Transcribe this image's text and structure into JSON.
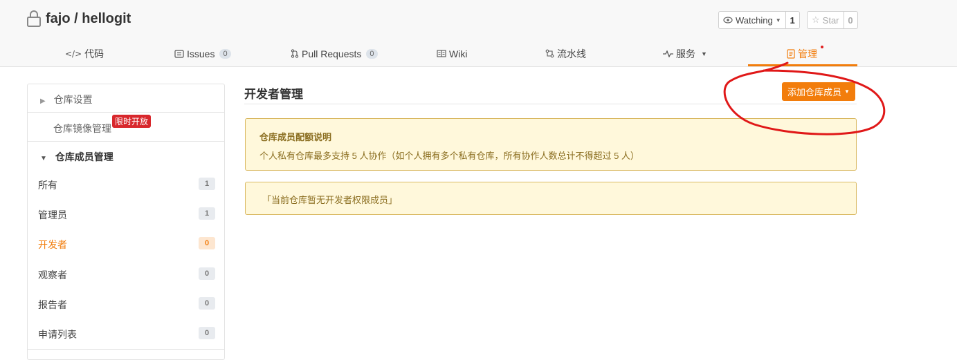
{
  "header": {
    "repo_path": "fajo / hellogit",
    "watch_label": "Watching",
    "watch_count": "1",
    "star_label": "Star",
    "star_count": "0"
  },
  "tabs": [
    {
      "label": "代码",
      "icon": "code-icon"
    },
    {
      "label": "Issues",
      "icon": "issues-icon",
      "count": "0"
    },
    {
      "label": "Pull Requests",
      "icon": "pull-request-icon",
      "count": "0"
    },
    {
      "label": "Wiki",
      "icon": "wiki-icon"
    },
    {
      "label": "流水线",
      "icon": "pipeline-icon"
    },
    {
      "label": "服务",
      "icon": "pulse-icon"
    },
    {
      "label": "管理",
      "icon": "manage-icon",
      "active": true
    }
  ],
  "sidebar": {
    "repo_settings": "仓库设置",
    "mirror_management": "仓库镜像管理",
    "limited_badge": "限时开放",
    "members_section": "仓库成员管理",
    "items": [
      {
        "label": "所有",
        "count": "1"
      },
      {
        "label": "管理员",
        "count": "1"
      },
      {
        "label": "开发者",
        "count": "0",
        "active": true
      },
      {
        "label": "观察者",
        "count": "0"
      },
      {
        "label": "报告者",
        "count": "0"
      },
      {
        "label": "申请列表",
        "count": "0"
      }
    ]
  },
  "main": {
    "title": "开发者管理",
    "add_button": "添加仓库成员",
    "quota_title": "仓库成员配额说明",
    "quota_body": "个人私有仓库最多支持 5 人协作（如个人拥有多个私有仓库，所有协作人数总计不得超过 5 人）",
    "empty_notice": "「当前仓库暂无开发者权限成员」"
  },
  "colors": {
    "accent": "#f27d0c",
    "notice_bg": "#fff8db",
    "notice_border": "#d9b860",
    "badge_red": "#d8272c",
    "annotation_red": "#e01818"
  }
}
